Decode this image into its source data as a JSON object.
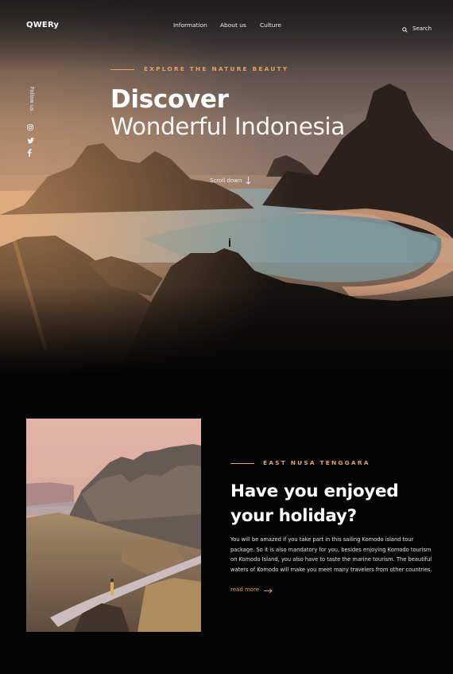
{
  "nav": {
    "logo": "QWERy",
    "links": [
      "Information",
      "About us",
      "Culture"
    ],
    "search_label": "Search"
  },
  "hero": {
    "eyebrow": "EXPLORE THE NATURE BEAUTY",
    "title": "Discover",
    "subtitle": "Wonderful Indonesia",
    "scroll_label": "Scroll down",
    "follow_label": "Follow us",
    "social_icons": [
      "instagram-icon",
      "twitter-icon",
      "facebook-icon"
    ]
  },
  "feature": {
    "eyebrow": "EAST NUSA TENGGARA",
    "title": "Have you enjoyed your holiday?",
    "body": "You will be amazed if you take part in this sailing Komodo island tour package. So it is also mandatory for you, besides enjoying Komodo tourism on Komodo Island, you also have to taste the marine tourism. The beautiful waters of Komodo will make you meet many travelers from other countries.",
    "cta": "read more"
  },
  "colors": {
    "accent": "#e0a465",
    "background": "#040404",
    "text": "#ffffff"
  }
}
